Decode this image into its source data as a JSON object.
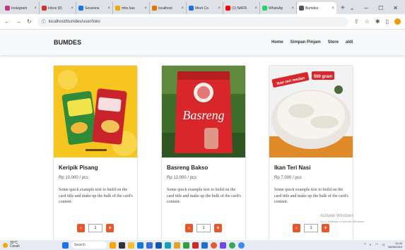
{
  "browser": {
    "tabs": [
      {
        "label": "Instagram",
        "color": "#c13584"
      },
      {
        "label": "Inbox (8)",
        "color": "#d93025"
      },
      {
        "label": "Sessions",
        "color": "#1a73e8"
      },
      {
        "label": "mbs kas",
        "color": "#f4a700"
      },
      {
        "label": "localhost",
        "color": "#e37400"
      },
      {
        "label": "Meet Ca",
        "color": "#1a73e8"
      },
      {
        "label": "(1) NAFR",
        "color": "#ff0000"
      },
      {
        "label": "WhatsAp",
        "color": "#25d366"
      },
      {
        "label": "Bumdes",
        "color": "#555555"
      }
    ],
    "url": "localhost/bumdes/user/toko"
  },
  "navbar": {
    "brand": "BUMDES",
    "links": [
      "Home",
      "Simpan Pinjam",
      "Store",
      "aldi"
    ]
  },
  "products": [
    {
      "title": "Keripik Pisang",
      "price": "Rp 10.000 / pcs",
      "description": "Some quick example text to build on the card title and make up the bulk of the card's content.",
      "quantity": "1"
    },
    {
      "title": "Basreng Bakso",
      "price": "Rp 12.000 / pcs",
      "description": "Some quick example text to build on the card title and make up the bulk of the card's content.",
      "quantity": "1",
      "package_text": "Basreng"
    },
    {
      "title": "Ikan Teri Nasi",
      "price": "Rp 7.000 / pcs",
      "description": "Some quick example text to build on the card title and make up the bulk of the card's content.",
      "quantity": "1",
      "tag_left": "ikan teri medan",
      "tag_right": "500 gram"
    }
  ],
  "buttons": {
    "minus": "-",
    "plus": "+"
  },
  "watermark": {
    "title": "Activate Windows",
    "subtitle": "Go to Settings to activate Windows."
  },
  "taskbar": {
    "temp": "30°C",
    "weather": "Cerah",
    "search": "Search",
    "time": "13:30",
    "date": "08/06/2023"
  }
}
